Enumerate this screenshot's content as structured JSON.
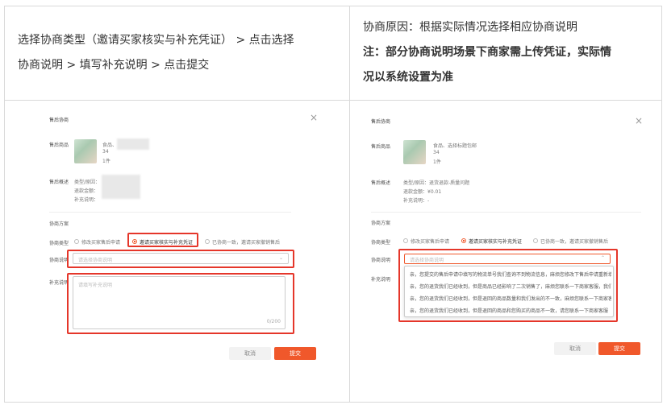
{
  "left_header": {
    "line1": "选择协商类型（邀请买家核实与补充凭证） > 点击选择",
    "line2": "协商说明 > 填写补充说明 > 点击提交"
  },
  "right_header": {
    "line1": "协商原因：根据实际情况选择相应协商说明",
    "line2": "注：部分协商说明场景下商家需上传凭证，实际情",
    "line3": "况以系统设置为准"
  },
  "left_dialog": {
    "title": "售后协商",
    "goods_label": "售后商品",
    "goods_name": "食品、",
    "goods_qty": "34",
    "goods_count": "1件",
    "overview_label": "售后概述",
    "type_row": "类型/原因：",
    "amount_row": "退款金额：",
    "note_row": "补充说明：",
    "plan_label": "协商方案",
    "nego_type_label": "协商类型",
    "opt1": "修改买家售后申请",
    "opt2": "邀请买家核实与补充凭证",
    "opt3": "已协商一致，邀请买家撤销售后",
    "desc_label": "协商说明",
    "desc_placeholder": "请选择协商说明",
    "supp_label": "补充说明",
    "supp_placeholder": "请填写补充说明",
    "counter": "0/200",
    "cancel": "取消",
    "submit": "提交"
  },
  "right_dialog": {
    "title": "售后协商",
    "goods_label": "售后商品",
    "goods_name": "食品、选择标题包邮",
    "goods_qty": "34",
    "goods_count": "1件",
    "overview_label": "售后概述",
    "type_row": "类型/原因：退货退款-质量问题",
    "amount_row": "退款金额：¥0.01",
    "note_row": "补充说明：-",
    "plan_label": "协商方案",
    "nego_type_label": "协商类型",
    "opt1": "修改买家售后申请",
    "opt2": "邀请买家核实与补充凭证",
    "opt3": "已协商一致，邀请买家撤销售后",
    "desc_label": "协商说明",
    "desc_placeholder": "请选择协商说明",
    "supp_label": "补充说明",
    "options": [
      "亲，您提交的售后申请中填写的物流单号我们查询不到物流信息，麻烦您修改下售后申请重新填",
      "亲，您的退货我们已经收到，但是商品已经影响了二次销售了，麻烦您联系一下商家客服，我们",
      "亲，您的退货我们已经收到，但是退回的商品数量和我们发出的不一致，麻烦您联系一下商家客",
      "亲，您的退货我们已经收到，但是退回的商品和您购买的商品不一致，请您联系一下商家客服"
    ],
    "cancel": "取消",
    "submit": "提交"
  },
  "colors": {
    "accent": "#f0582b",
    "highlight": "#e5362a"
  }
}
